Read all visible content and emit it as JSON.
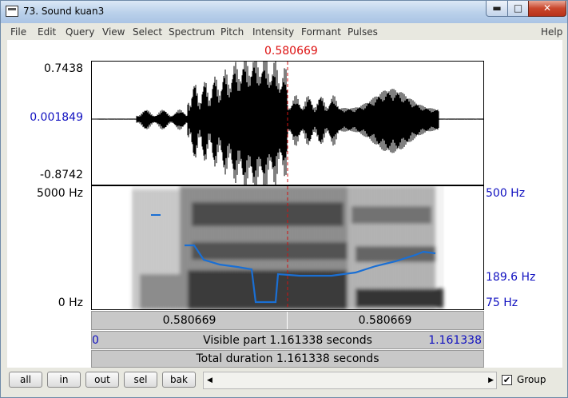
{
  "window": {
    "title": "73. Sound kuan3",
    "min_glyph": "▬",
    "max_glyph": "□",
    "close_glyph": "✕"
  },
  "menus": [
    "File",
    "Edit",
    "Query",
    "View",
    "Select",
    "Spectrum",
    "Pitch",
    "Intensity",
    "Formant",
    "Pulses",
    "Help"
  ],
  "cursor_time": "0.580669",
  "waveform": {
    "max": "0.7438",
    "mid": "0.001849",
    "min": "-0.8742"
  },
  "spectrogram": {
    "freq_top": "5000 Hz",
    "freq_bottom": "0 Hz",
    "pitch_top": "500 Hz",
    "pitch_mid": "189.6 Hz",
    "pitch_bottom": "75 Hz"
  },
  "bars": {
    "left_time": "0.580669",
    "right_time": "0.580669",
    "visible_start": "0",
    "visible_text": "Visible part 1.161338 seconds",
    "visible_end": "1.161338",
    "total_text": "Total duration 1.161338 seconds"
  },
  "buttons": {
    "all": "all",
    "in": "in",
    "out": "out",
    "sel": "sel",
    "bak": "bak"
  },
  "group": {
    "label": "Group",
    "checked_glyph": "✔"
  },
  "colors": {
    "cursor": "#d11111",
    "pitch": "#1a6fd4",
    "label_blue": "#1010c0"
  }
}
